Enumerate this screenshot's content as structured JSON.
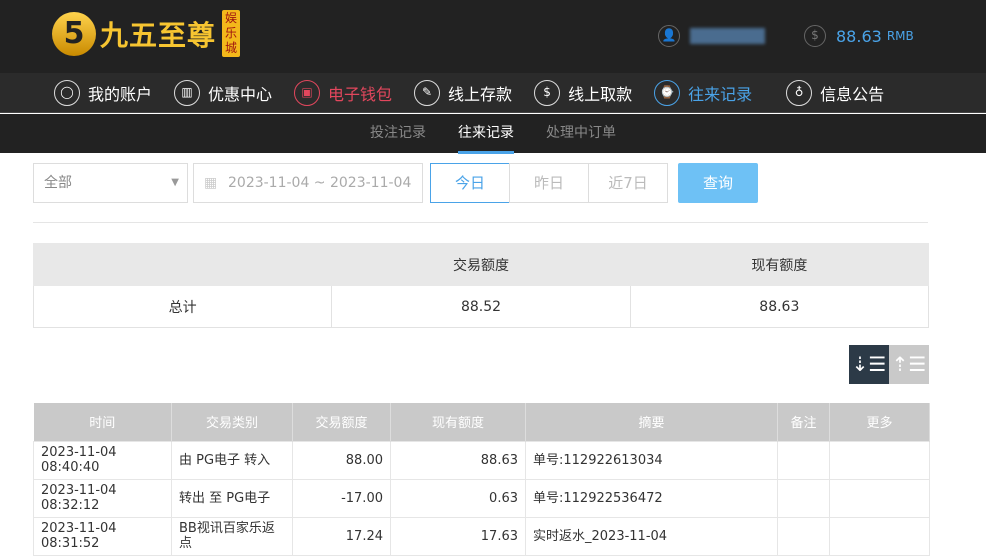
{
  "header": {
    "logo_digit": "5",
    "logo_name": "九五至尊",
    "logo_tag": "娱乐城",
    "balance": "88.63",
    "currency": "RMB"
  },
  "nav": [
    {
      "label": "我的账户",
      "icon": "user-icon"
    },
    {
      "label": "优惠中心",
      "icon": "gift-icon"
    },
    {
      "label": "电子钱包",
      "icon": "wallet-icon"
    },
    {
      "label": "线上存款",
      "icon": "deposit-icon"
    },
    {
      "label": "线上取款",
      "icon": "withdraw-icon"
    },
    {
      "label": "往来记录",
      "icon": "records-icon"
    },
    {
      "label": "信息公告",
      "icon": "bell-icon"
    }
  ],
  "subnav": [
    "投注记录",
    "往来记录",
    "处理中订单"
  ],
  "filters": {
    "type": "全部",
    "date_range": "2023-11-04 ~ 2023-11-04",
    "quick": [
      "今日",
      "昨日",
      "近7日"
    ],
    "search": "查询"
  },
  "summary": {
    "headers": [
      "",
      "交易额度",
      "现有额度"
    ],
    "label": "总计",
    "trade": "88.52",
    "current": "88.63"
  },
  "table": {
    "headers": [
      "时间",
      "交易类别",
      "交易额度",
      "现有额度",
      "摘要",
      "备注",
      "更多"
    ],
    "rows": [
      [
        "2023-11-04 08:40:40",
        "由 PG电子 转入",
        "88.00",
        "88.63",
        "单号:112922613034",
        "",
        ""
      ],
      [
        "2023-11-04 08:32:12",
        "转出 至 PG电子",
        "-17.00",
        "0.63",
        "单号:112922536472",
        "",
        ""
      ],
      [
        "2023-11-04 08:31:52",
        "BB视讯百家乐返点",
        "17.24",
        "17.63",
        "实时返水_2023-11-04",
        "",
        ""
      ]
    ]
  },
  "colors": {
    "accent": "#4aa3e8",
    "active_red": "#e2475d",
    "search_btn": "#6ec1f5"
  }
}
